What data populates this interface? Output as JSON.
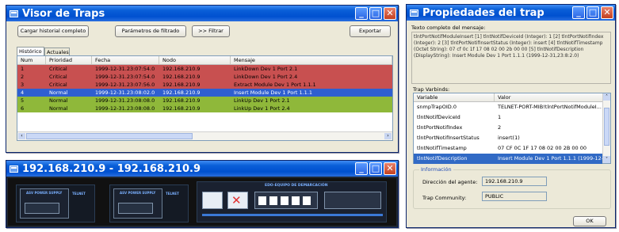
{
  "traps_window": {
    "title": "Visor de Traps",
    "buttons": {
      "load_history": "Cargar historial completo",
      "filter_params": "Parámetros de filtrado",
      "filter": ">> Filtrar",
      "export": "Exportar"
    },
    "tabs": [
      "Histórico",
      "Actuales"
    ],
    "columns": [
      "Num",
      "Prioridad",
      "Fecha",
      "Nodo",
      "Mensaje"
    ],
    "rows": [
      {
        "num": "1",
        "priority": "Critical",
        "date": "1999-12-31.23:07:54.0",
        "node": "192.168.210.9",
        "message": "LinkDown Dev 1 Port 2.1",
        "color": "#c85050"
      },
      {
        "num": "2",
        "priority": "Critical",
        "date": "1999-12-31.23:07:54.0",
        "node": "192.168.210.9",
        "message": "LinkDown Dev 1 Port 2.4",
        "color": "#c85050"
      },
      {
        "num": "3",
        "priority": "Critical",
        "date": "1999-12-31.23:07:56.0",
        "node": "192.168.210.9",
        "message": "Extract Module Dev 1 Port 1.1.1",
        "color": "#c85050"
      },
      {
        "num": "4",
        "priority": "Normal",
        "date": "1999-12-31.23:08:02.0",
        "node": "192.168.210.9",
        "message": "Insert Module Dev 1 Port 1.1.1",
        "color": "#2f5fd0",
        "selected": true
      },
      {
        "num": "5",
        "priority": "Normal",
        "date": "1999-12-31.23:08:08.0",
        "node": "192.168.210.9",
        "message": "LinkUp Dev 1 Port 2.1",
        "color": "#8fb83a"
      },
      {
        "num": "6",
        "priority": "Normal",
        "date": "1999-12-31.23:08:08.0",
        "node": "192.168.210.9",
        "message": "LinkUp Dev 1 Port 2.4",
        "color": "#8fb83a"
      }
    ]
  },
  "device_window": {
    "title": "192.168.210.9 - 192.168.210.9",
    "psu_labels": [
      "ASV POWER SUPPLY",
      "ASV POWER SUPPLY"
    ],
    "brand": "TELNET",
    "panel_label": "EDO-EQUIPO DE DEMARCACIÓN"
  },
  "props_window": {
    "title": "Propiedades del trap",
    "message_label": "Texto completo del mensaje:",
    "message_text": "tlntPortNotifModuleInsert [1] tlntNotifDeviceId (Integer): 1 [2] tlntPortNotifIndex (Integer): 2 [3] tlntPortNotifInsertStatus (Integer): insert [4] tlntNotifTimestamp (Octet String): 07 cf 0c 1f 17 08 02 00 2b 00 00 [5] tlntNotifDescription (DisplayString): Insert Module Dev 1 Port 1.1.1 (1999-12-31,23:8:2.0)",
    "varbinds_label": "Trap Varbinds:",
    "varbind_columns": [
      "Variable",
      "Valor"
    ],
    "varbinds": [
      {
        "variable": "snmpTrapOID.0",
        "value": "TELNET-PORT-MIB!tlntPortNotifModuleI..."
      },
      {
        "variable": "tlntNotifDeviceId",
        "value": "1"
      },
      {
        "variable": "tlntPortNotifIndex",
        "value": "2"
      },
      {
        "variable": "tlntPortNotifInsertStatus",
        "value": "insert(1)"
      },
      {
        "variable": "tlntNotifTimestamp",
        "value": "07 CF 0C 1F 17 08 02 00 2B 00 00"
      },
      {
        "variable": "tlntNotifDescription",
        "value": "Insert Module Dev 1 Port 1.1.1 (1999-12-...",
        "selected": true
      }
    ],
    "info_group": "Información",
    "agent_label": "Dirección del agente:",
    "agent_value": "192.168.210.9",
    "community_label": "Trap Community:",
    "community_value": "PUBLIC",
    "ok": "OK"
  }
}
